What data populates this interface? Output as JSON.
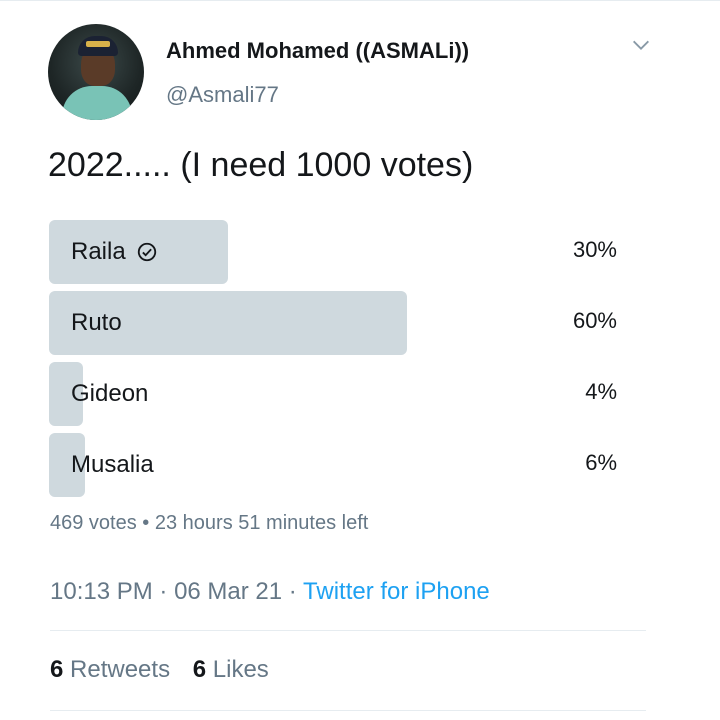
{
  "user": {
    "display_name": "Ahmed Mohamed ((ASMALi))",
    "handle": "@Asmali77"
  },
  "tweet": {
    "text": "2022..... (I need 1000 votes)"
  },
  "poll": {
    "options": [
      {
        "label": "Raila",
        "percent": 30,
        "percent_label": "30%",
        "voted": true
      },
      {
        "label": "Ruto",
        "percent": 60,
        "percent_label": "60%",
        "voted": false
      },
      {
        "label": "Gideon",
        "percent": 4,
        "percent_label": "4%",
        "voted": false
      },
      {
        "label": "Musalia",
        "percent": 6,
        "percent_label": "6%",
        "voted": false
      }
    ],
    "votes_text": "469 votes",
    "separator": " • ",
    "time_left": "23 hours 51 minutes left"
  },
  "footer": {
    "time": "10:13 PM",
    "date": "06 Mar 21",
    "dot": " · ",
    "source": "Twitter for iPhone"
  },
  "stats": {
    "retweets_count": "6",
    "retweets_label": "Retweets",
    "likes_count": "6",
    "likes_label": "Likes"
  },
  "colors": {
    "bar": "#cfd9de",
    "link": "#1da1f2",
    "secondary": "#657786"
  },
  "icons": {
    "menu": "chevron-down-icon",
    "vote": "check-circle-icon"
  }
}
